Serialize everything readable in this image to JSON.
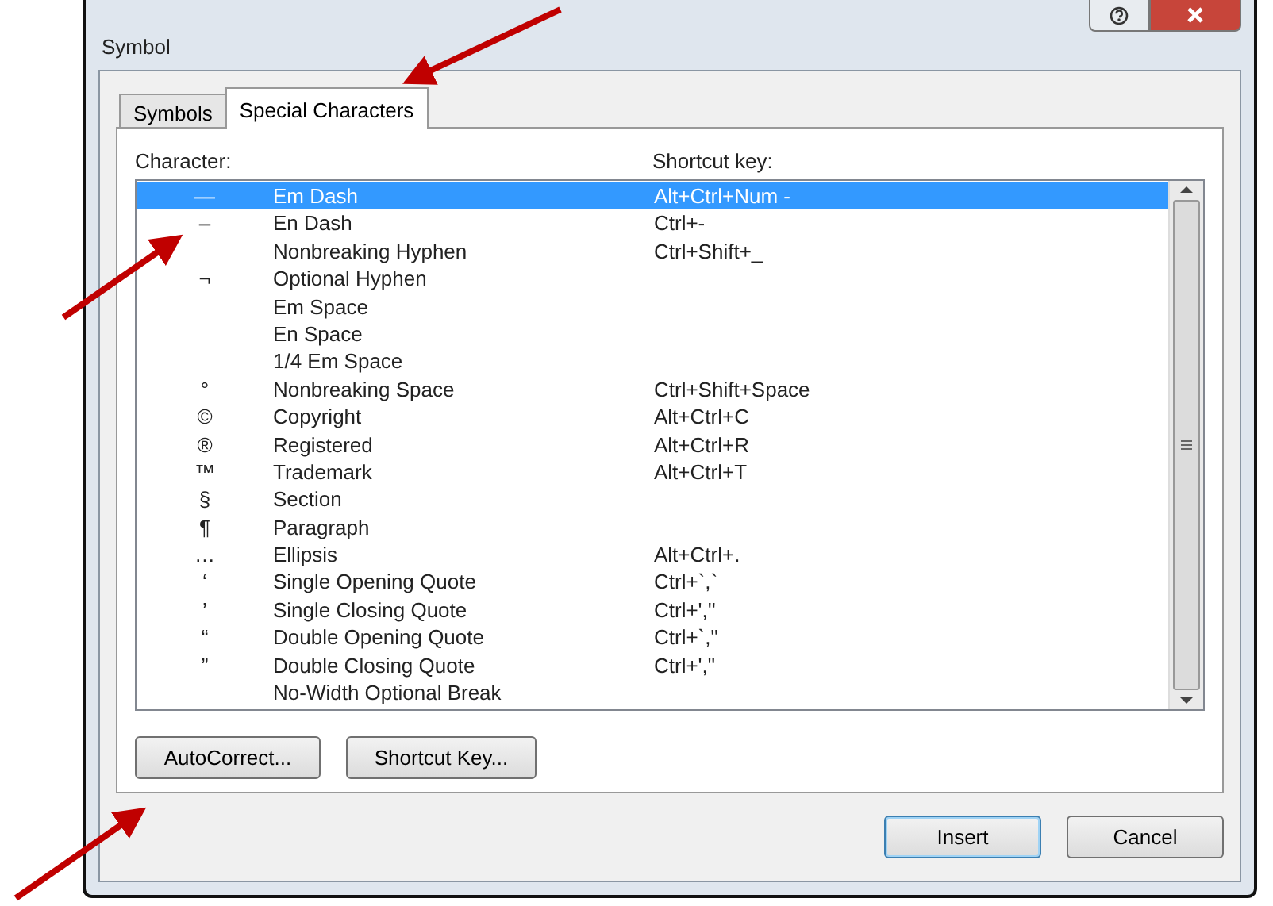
{
  "window": {
    "title": "Symbol"
  },
  "tabs": [
    {
      "label": "Symbols",
      "selected": false
    },
    {
      "label": "Special Characters",
      "selected": true
    }
  ],
  "list": {
    "columns": [
      "Character:",
      "Shortcut key:"
    ],
    "rows": [
      {
        "character": "—",
        "name": "Em Dash",
        "shortcut": "Alt+Ctrl+Num -",
        "selected": true
      },
      {
        "character": "–",
        "name": "En Dash",
        "shortcut": "Ctrl+-",
        "selected": false
      },
      {
        "name": "Nonbreaking Hyphen",
        "shortcut": "Ctrl+Shift+_",
        "selected": false
      },
      {
        "character": "¬",
        "name": "Optional Hyphen",
        "selected": false
      },
      {
        "name": "Em Space",
        "selected": false
      },
      {
        "name": "En Space",
        "selected": false
      },
      {
        "name": "1/4 Em Space",
        "selected": false
      },
      {
        "character": "°",
        "name": "Nonbreaking Space",
        "shortcut": "Ctrl+Shift+Space",
        "selected": false
      },
      {
        "character": "©",
        "name": "Copyright",
        "shortcut": "Alt+Ctrl+C",
        "selected": false
      },
      {
        "character": "®",
        "name": "Registered",
        "shortcut": "Alt+Ctrl+R",
        "selected": false
      },
      {
        "character": "™",
        "name": "Trademark",
        "shortcut": "Alt+Ctrl+T",
        "selected": false
      },
      {
        "character": "§",
        "name": "Section",
        "selected": false
      },
      {
        "character": "¶",
        "name": "Paragraph",
        "selected": false
      },
      {
        "character": "…",
        "name": "Ellipsis",
        "shortcut": "Alt+Ctrl+.",
        "selected": false
      },
      {
        "character": "‘",
        "name": "Single Opening Quote",
        "shortcut": "Ctrl+`,`",
        "selected": false
      },
      {
        "character": "’",
        "name": "Single Closing Quote",
        "shortcut": "Ctrl+',''",
        "selected": false
      },
      {
        "character": "“",
        "name": "Double Opening Quote",
        "shortcut": "Ctrl+`,\"",
        "selected": false
      },
      {
        "character": "”",
        "name": "Double Closing Quote",
        "shortcut": "Ctrl+',\"",
        "selected": false
      },
      {
        "name": "No-Width Optional Break",
        "selected": false
      }
    ]
  },
  "tab_buttons": [
    "AutoCorrect...",
    "Shortcut Key..."
  ],
  "buttons": [
    {
      "label": "Insert",
      "default": true
    },
    {
      "label": "Cancel",
      "default": false
    }
  ]
}
